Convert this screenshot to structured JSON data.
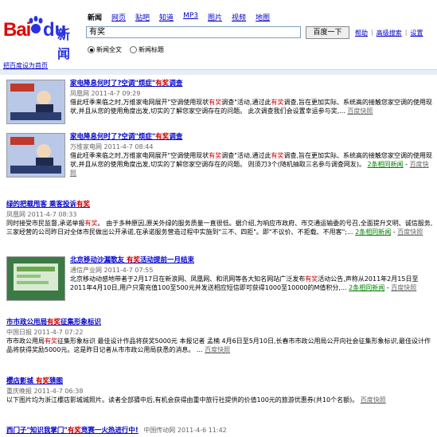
{
  "logo": {
    "bai": "Bai",
    "du": "du",
    "xinwen": "新闻"
  },
  "nav": [
    "新闻",
    "网页",
    "贴吧",
    "知道",
    "MP3",
    "图片",
    "视频",
    "地图"
  ],
  "search": {
    "value": "有奖",
    "button": "百度一下"
  },
  "links": [
    "帮助",
    "高级搜索",
    "设置"
  ],
  "radios": [
    {
      "label": "新闻全文",
      "checked": true
    },
    {
      "label": "新闻标题",
      "checked": false
    }
  ],
  "set_homepage": "把百度设为首页",
  "results": [
    {
      "title": "家电降息何时了?空调\"烦症\"有奖调查",
      "source": "凤凰网 2011-4-7 09:29",
      "snippet": "借此旺季来临之时,万维家电网展开\"空调使用现状有奖调查\"活动,通过此有奖调查,旨在更加实际、系统高的接触您家空调的使用现状,并且从您的使用角度出发,切实的了解您家空调存在的问题。 此次调查我们会设置幸运参与奖,...",
      "snapshot": "百度快照"
    },
    {
      "title": "家电降息何时了?空调\"烦症\"有奖调查",
      "source": "万维家电网 2011-4-7 08:44",
      "snippet": "借此旺季来临之时,万维家电网展开\"空调使用现状有奖调查\"活动,通过此有奖调查,旨在更加实际、系统高的接触您家空调的使用现状,并且从您的使用角度出发,切实的了解您家空调存在的问题。 则须刀3个(随机抽取三名参与调查网友)。",
      "related": "2条相同新闻",
      "snapshot": "百度快照"
    },
    {
      "title": "绿的把载甩客 乘客投诉有奖",
      "source": "凤凰网 2011-4-7 08:33",
      "snippet": "同时接受市民监督,承诺举报有奖。 由于多种原因,原关外绿的服务质量一直很低。据介绍,为响应市政府、市交通运输委的号召,全面提升文明、诚信服务,三家经营的公司昨日对全体市民做出公开承诺,在承诺服务营造过程中实施到\"三不、四拒\"。即\"不议价、不拒载、不甩客\";...",
      "related": "2条相同新闻",
      "snapshot": "百度快照"
    },
    {
      "title": "北京移动沙漏歌友 有奖活动提前一月结束",
      "source": "通信产业网 2011-4-7 07:55",
      "snippet": "北京移动动感地带者于2月17日在新浪网、凤凰网、和讯网等各大知名网站广泛发布有奖活动公告,声称从2011年2月15日至2011年4月10日,用户只需充值100至500元并发送相应短信即可获得1000至10000的M值积分,...",
      "related": "2条相同新闻",
      "snapshot": "百度快照"
    },
    {
      "title": "市市政公用局有奖征集形象标识",
      "source": "中国日报 2011-4-7 07:22",
      "snippet": "市市政公用局有奖征集形象标识 最佳设计作品将获奖5000元 本报记者 孟楠 4月6日至5月10日,长春市市政公用局公开向社会征集形象标识,最佳设计作品将获得奖励5000元。这是昨日记者从市市政公用局获悉的消息。 ...",
      "snapshot": "百度快照"
    },
    {
      "title": "櫻店影城 有奖猜图",
      "source": "重庆晚报 2011-4-7 06:38",
      "snippet": "以下图片均为浙江櫻店影城城照片。读者全部猜中后,有机会获得由重中旅行社提供的价值100元的旅游优惠券(共10个名额)。",
      "snapshot": "百度快照"
    },
    {
      "title": "西门子\"知识我掌门\"有奖竞赛一火热进行中!",
      "source": "中国传动网 2011-4-6 11:42"
    }
  ]
}
